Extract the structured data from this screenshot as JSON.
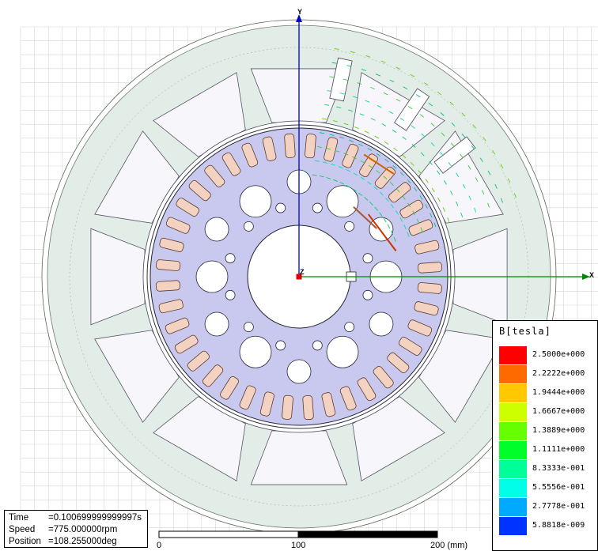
{
  "legend": {
    "title": "B[tesla]",
    "entries": [
      {
        "label": "2.5000e+000",
        "color": "#ff0000"
      },
      {
        "label": "2.2222e+000",
        "color": "#ff6a00"
      },
      {
        "label": "1.9444e+000",
        "color": "#ffc800"
      },
      {
        "label": "1.6667e+000",
        "color": "#ccff00"
      },
      {
        "label": "1.3889e+000",
        "color": "#66ff00"
      },
      {
        "label": "1.1111e+000",
        "color": "#00ff2a"
      },
      {
        "label": "8.3333e-001",
        "color": "#00ff99"
      },
      {
        "label": "5.5556e-001",
        "color": "#00ffe6"
      },
      {
        "label": "2.7778e-001",
        "color": "#00aaff"
      },
      {
        "label": "5.8818e-009",
        "color": "#0033ff"
      }
    ]
  },
  "info": {
    "time_key": "Time",
    "time_value": "=0.100699999999997s",
    "speed_key": "Speed",
    "speed_value": "=775.000000rpm",
    "position_key": "Position",
    "position_value": "=108.255000deg"
  },
  "scale": {
    "label_0": "0",
    "label_100": "100",
    "label_200": "200 (mm)"
  },
  "axes": {
    "y_label": "Y",
    "x_label": "X",
    "z_label": "Z"
  },
  "colors": {
    "stator": "#e2ede8",
    "rotor": "#c9c9f0",
    "slot_fill": "#f3d2c2",
    "y_axis": "#0000cc",
    "x_axis": "#008800",
    "grid": "#d6d6d6"
  }
}
